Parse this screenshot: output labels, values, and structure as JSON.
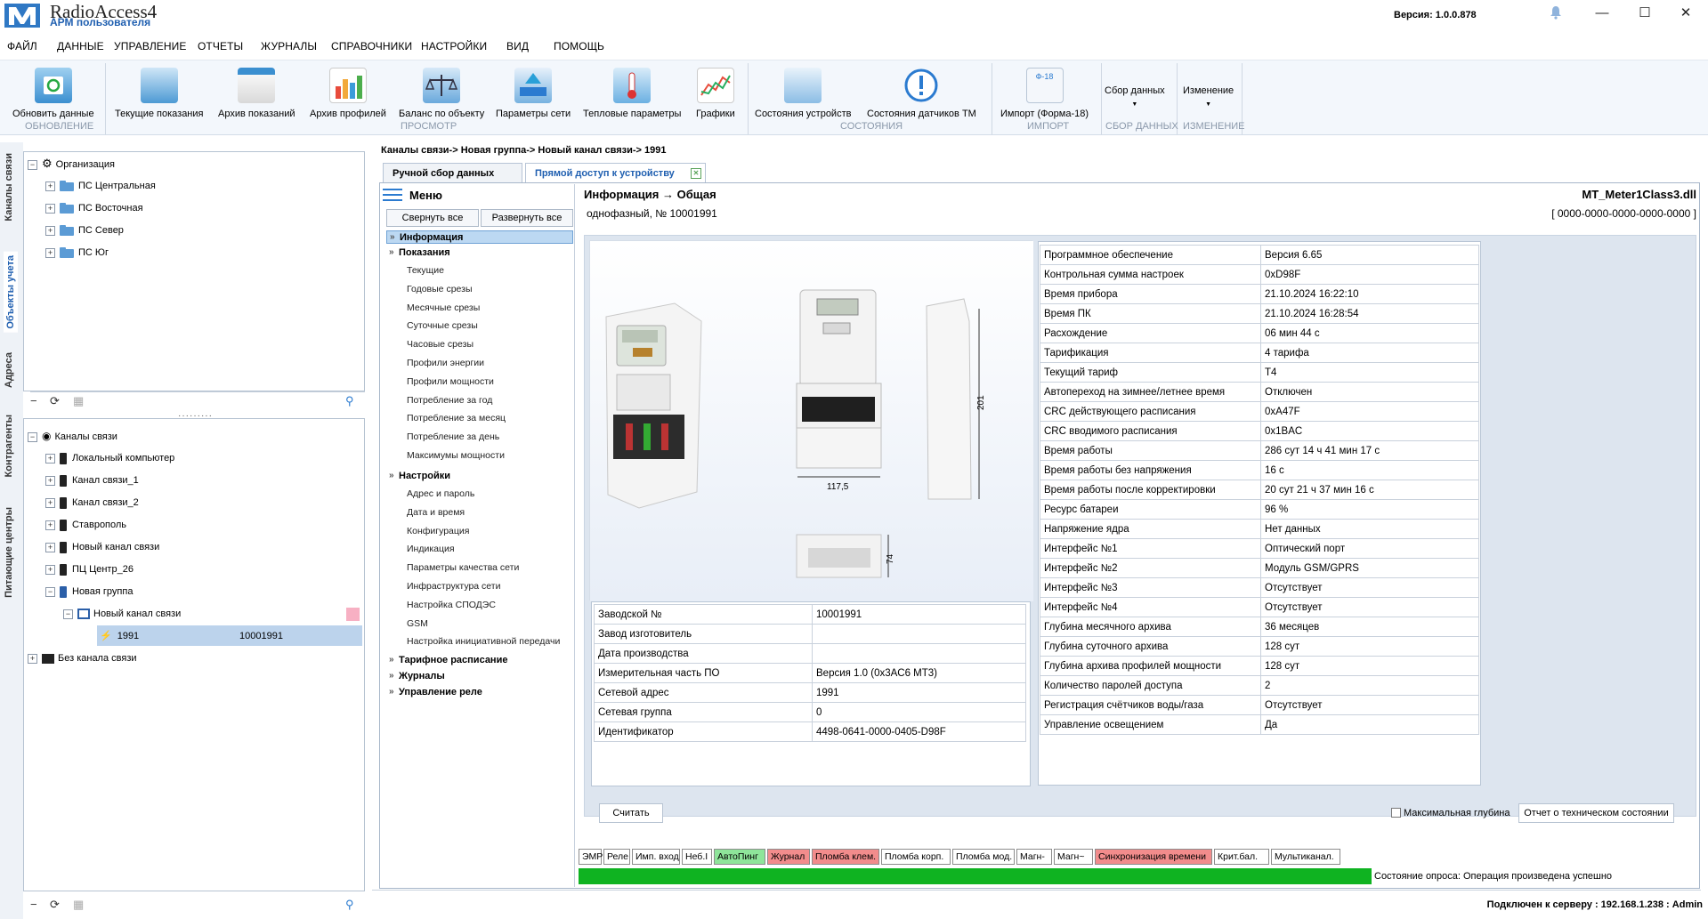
{
  "app": {
    "name": "RadioAccess4",
    "subtitle": "АРМ пользователя",
    "version": "Версия:  1.0.0.878"
  },
  "menubar": [
    "ФАЙЛ",
    "ДАННЫЕ",
    "УПРАВЛЕНИЕ",
    "ОТЧЕТЫ",
    "ЖУРНАЛЫ",
    "СПРАВОЧНИКИ",
    "НАСТРОЙКИ",
    "ВИД",
    "ПОМОЩЬ"
  ],
  "ribbon": {
    "buttons": [
      "Обновить данные",
      "Текущие показания",
      "Архив показаний",
      "Архив профилей",
      "Баланс по объекту",
      "Параметры сети",
      "Тепловые параметры",
      "Графики",
      "Состояния устройств",
      "Состояния датчиков ТМ",
      "Импорт (Форма-18)",
      "Сбор данных",
      "Изменение"
    ],
    "groups": [
      "ОБНОВЛЕНИЕ",
      "ПРОСМОТР",
      "СОСТОЯНИЯ",
      "ИМПОРТ",
      "СБОР ДАННЫХ",
      "ИЗМЕНЕНИЕ"
    ],
    "form18_badge": "Ф-18"
  },
  "left_tabs": [
    "Каналы связи",
    "Объекты учета",
    "Адреса",
    "Контрагенты",
    "Питающие центры"
  ],
  "tree_top": [
    "Организация",
    "ПС Центральная",
    "ПС Восточная",
    "ПС Север",
    "ПС Юг"
  ],
  "tree_bottom": [
    "Каналы связи",
    "Локальный компьютер",
    "Канал связи_1",
    "Канал связи_2",
    "Ставрополь",
    "Новый канал связи",
    "ПЦ Центр_26",
    "Новая группа",
    "Новый канал связи",
    "1991",
    "Без канала связи"
  ],
  "tree_selected_extra": "10001991",
  "breadcrumb": "Каналы связи->   Новая группа->   Новый канал связи->   1991",
  "tabs": [
    "Ручной сбор данных",
    "Прямой доступ к устройству"
  ],
  "menu": {
    "title": "Меню",
    "collapse_all": "Свернуть все",
    "expand_all": "Развернуть все",
    "sections": {
      "info": "Информация",
      "readings": "Показания",
      "settings": "Настройки",
      "tariff": "Тарифное расписание",
      "journals": "Журналы",
      "relay": "Управление реле"
    },
    "readings_items": [
      "Текущие",
      "Годовые срезы",
      "Месячные срезы",
      "Суточные срезы",
      "Часовые срезы",
      "Профили энергии",
      "Профили мощности",
      "Потребление за год",
      "Потребление за месяц",
      "Потребление за день",
      "Максимумы мощности"
    ],
    "settings_items": [
      "Адрес и пароль",
      "Дата и время",
      "Конфигурация",
      "Индикация",
      "Параметры качества сети",
      "Инфраструктура сети",
      "Настройка СПОДЭС",
      "GSM",
      "Настройка инициативной передачи"
    ]
  },
  "info": {
    "heading": "Информация → Общая",
    "subheading": "однофазный, № 10001991",
    "dll": "MT_Meter1Class3.dll",
    "guid": "[ 0000-0000-0000-0000-0000 ]",
    "dims": {
      "height": "201",
      "width": "117,5",
      "depth": "74"
    },
    "left_table": [
      [
        "Заводской №",
        "10001991"
      ],
      [
        "Завод изготовитель",
        ""
      ],
      [
        "Дата производства",
        ""
      ],
      [
        "Измерительная часть ПО",
        "Версия 1.0 (0x3AC6 MT3)"
      ],
      [
        "Сетевой адрес",
        "1991"
      ],
      [
        "Сетевая группа",
        "0"
      ],
      [
        "Идентификатор",
        "4498-0641-0000-0405-D98F"
      ]
    ],
    "right_table": [
      [
        "Программное обеспечение",
        "Версия 6.65"
      ],
      [
        "Контрольная сумма настроек",
        "0xD98F"
      ],
      [
        "Время прибора",
        "21.10.2024 16:22:10"
      ],
      [
        "Время ПК",
        "21.10.2024 16:28:54"
      ],
      [
        "Расхождение",
        "06 мин 44 с"
      ],
      [
        "Тарификация",
        "4 тарифа"
      ],
      [
        "Текущий тариф",
        "T4"
      ],
      [
        "Автопереход на зимнее/летнее время",
        "Отключен"
      ],
      [
        "CRC действующего расписания",
        "0xA47F"
      ],
      [
        "CRC вводимого расписания",
        "0x1BAC"
      ],
      [
        "Время работы",
        "286 сут 14 ч 41 мин 17 с"
      ],
      [
        "Время работы без напряжения",
        "16 с"
      ],
      [
        "Время работы после корректировки",
        "20 сут 21 ч 37 мин 16 с"
      ],
      [
        "Ресурс батареи",
        "96 %"
      ],
      [
        "Напряжение ядра",
        "Нет данных"
      ],
      [
        "Интерфейс №1",
        "Оптический порт"
      ],
      [
        "Интерфейс №2",
        "Модуль GSM/GPRS"
      ],
      [
        "Интерфейс №3",
        "Отсутствует"
      ],
      [
        "Интерфейс №4",
        "Отсутствует"
      ],
      [
        "Глубина месячного архива",
        "36 месяцев"
      ],
      [
        "Глубина суточного архива",
        "128 сут"
      ],
      [
        "Глубина архива профилей мощности",
        "128 сут"
      ],
      [
        "Количество паролей доступа",
        "2"
      ],
      [
        "Регистрация счётчиков воды/газа",
        "Отсутствует"
      ],
      [
        "Управление освещением",
        "Да"
      ]
    ],
    "read_button": "Считать",
    "max_depth": "Максимальная глубина",
    "tech_report": "Отчет о техническом состоянии"
  },
  "status_badges": [
    {
      "label": "ЭМР",
      "color": "#ffffff"
    },
    {
      "label": "Реле",
      "color": "#ffffff"
    },
    {
      "label": "Имп. вход",
      "color": "#ffffff"
    },
    {
      "label": "Неб.I",
      "color": "#ffffff"
    },
    {
      "label": "АвтоПинг",
      "color": "#8ee59a"
    },
    {
      "label": "Журнал",
      "color": "#f28c8c"
    },
    {
      "label": "Пломба клем.",
      "color": "#f28c8c"
    },
    {
      "label": "Пломба корп.",
      "color": "#ffffff"
    },
    {
      "label": "Пломба мод.",
      "color": "#ffffff"
    },
    {
      "label": "Магн-",
      "color": "#ffffff"
    },
    {
      "label": "Магн~",
      "color": "#ffffff"
    },
    {
      "label": "Синхронизация времени",
      "color": "#f28c8c"
    },
    {
      "label": "Крит.бал.",
      "color": "#ffffff"
    },
    {
      "label": "Мультиканал.",
      "color": "#ffffff"
    }
  ],
  "poll_status": "Состояние опроса:  Операция произведена успешно",
  "connection": "Подключен к серверу : 192.168.1.238 : Admin"
}
